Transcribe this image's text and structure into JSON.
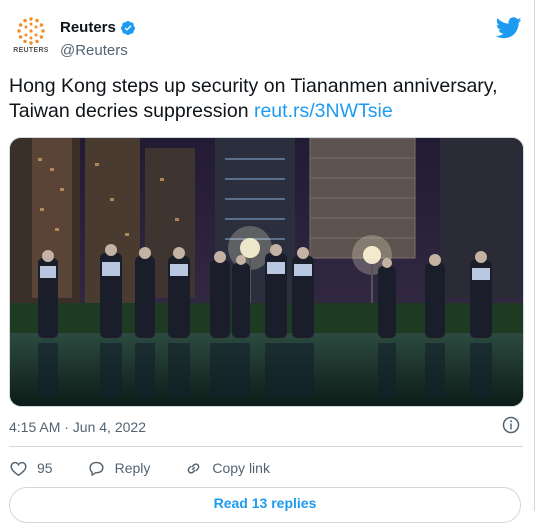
{
  "author": {
    "display_name": "Reuters",
    "handle": "@Reuters",
    "logo_word": "REUTERS"
  },
  "tweet": {
    "text": "Hong Kong steps up security on Tiananmen anniversary, Taiwan decries suppression ",
    "link_text": "reut.rs/3NWTsie",
    "timestamp": "4:15 AM · Jun 4, 2022"
  },
  "actions": {
    "like_count": "95",
    "reply_label": "Reply",
    "copy_label": "Copy link"
  },
  "replies_button": "Read 13 replies",
  "icons": {
    "platform": "bird-icon",
    "verified": "verified-badge-icon",
    "info": "info-icon",
    "like": "heart-icon",
    "reply": "speech-bubble-icon",
    "copy": "link-icon"
  },
  "colors": {
    "accent": "#1d9bf0",
    "secondary_text": "#536471",
    "reuters_orange": "#f28c28"
  },
  "media": {
    "description": ""
  }
}
